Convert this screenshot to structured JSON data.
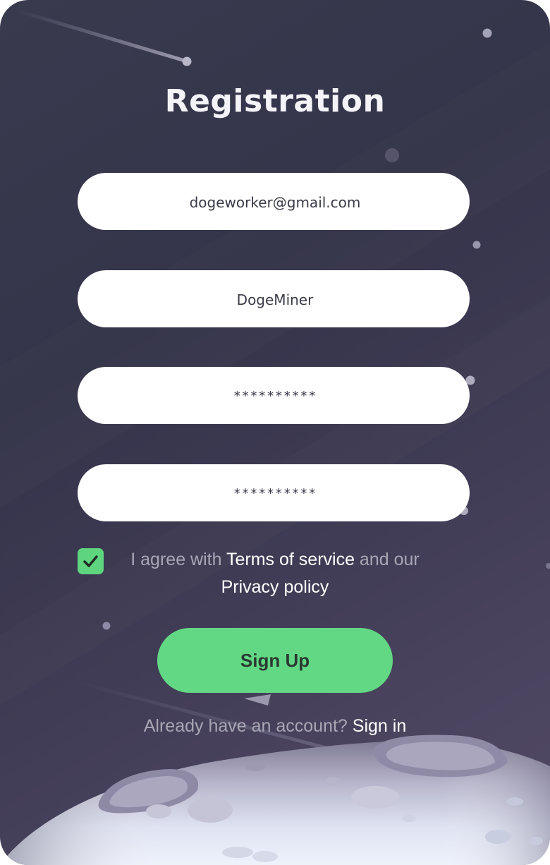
{
  "screen": {
    "title": "Registration"
  },
  "form": {
    "email_value": "dogeworker@gmail.com",
    "username_value": "DogeMiner",
    "password_value": "**********",
    "confirm_password_value": "**********"
  },
  "agreement": {
    "checked": true,
    "text_before": "I agree with ",
    "terms_link": "Terms of service",
    "text_middle": " and our ",
    "privacy_link": "Privacy policy"
  },
  "actions": {
    "signup_label": "Sign Up",
    "already_text": "Already have an account? ",
    "signin_link": "Sign in"
  },
  "colors": {
    "accent_green": "#63d884",
    "background_dark": "#3a3a4f",
    "field_background": "#ffffff"
  },
  "icons": {
    "checkbox": "check-icon",
    "decor": [
      "shooting-star-icon",
      "star-dot-icon",
      "moon-surface-icon"
    ]
  }
}
